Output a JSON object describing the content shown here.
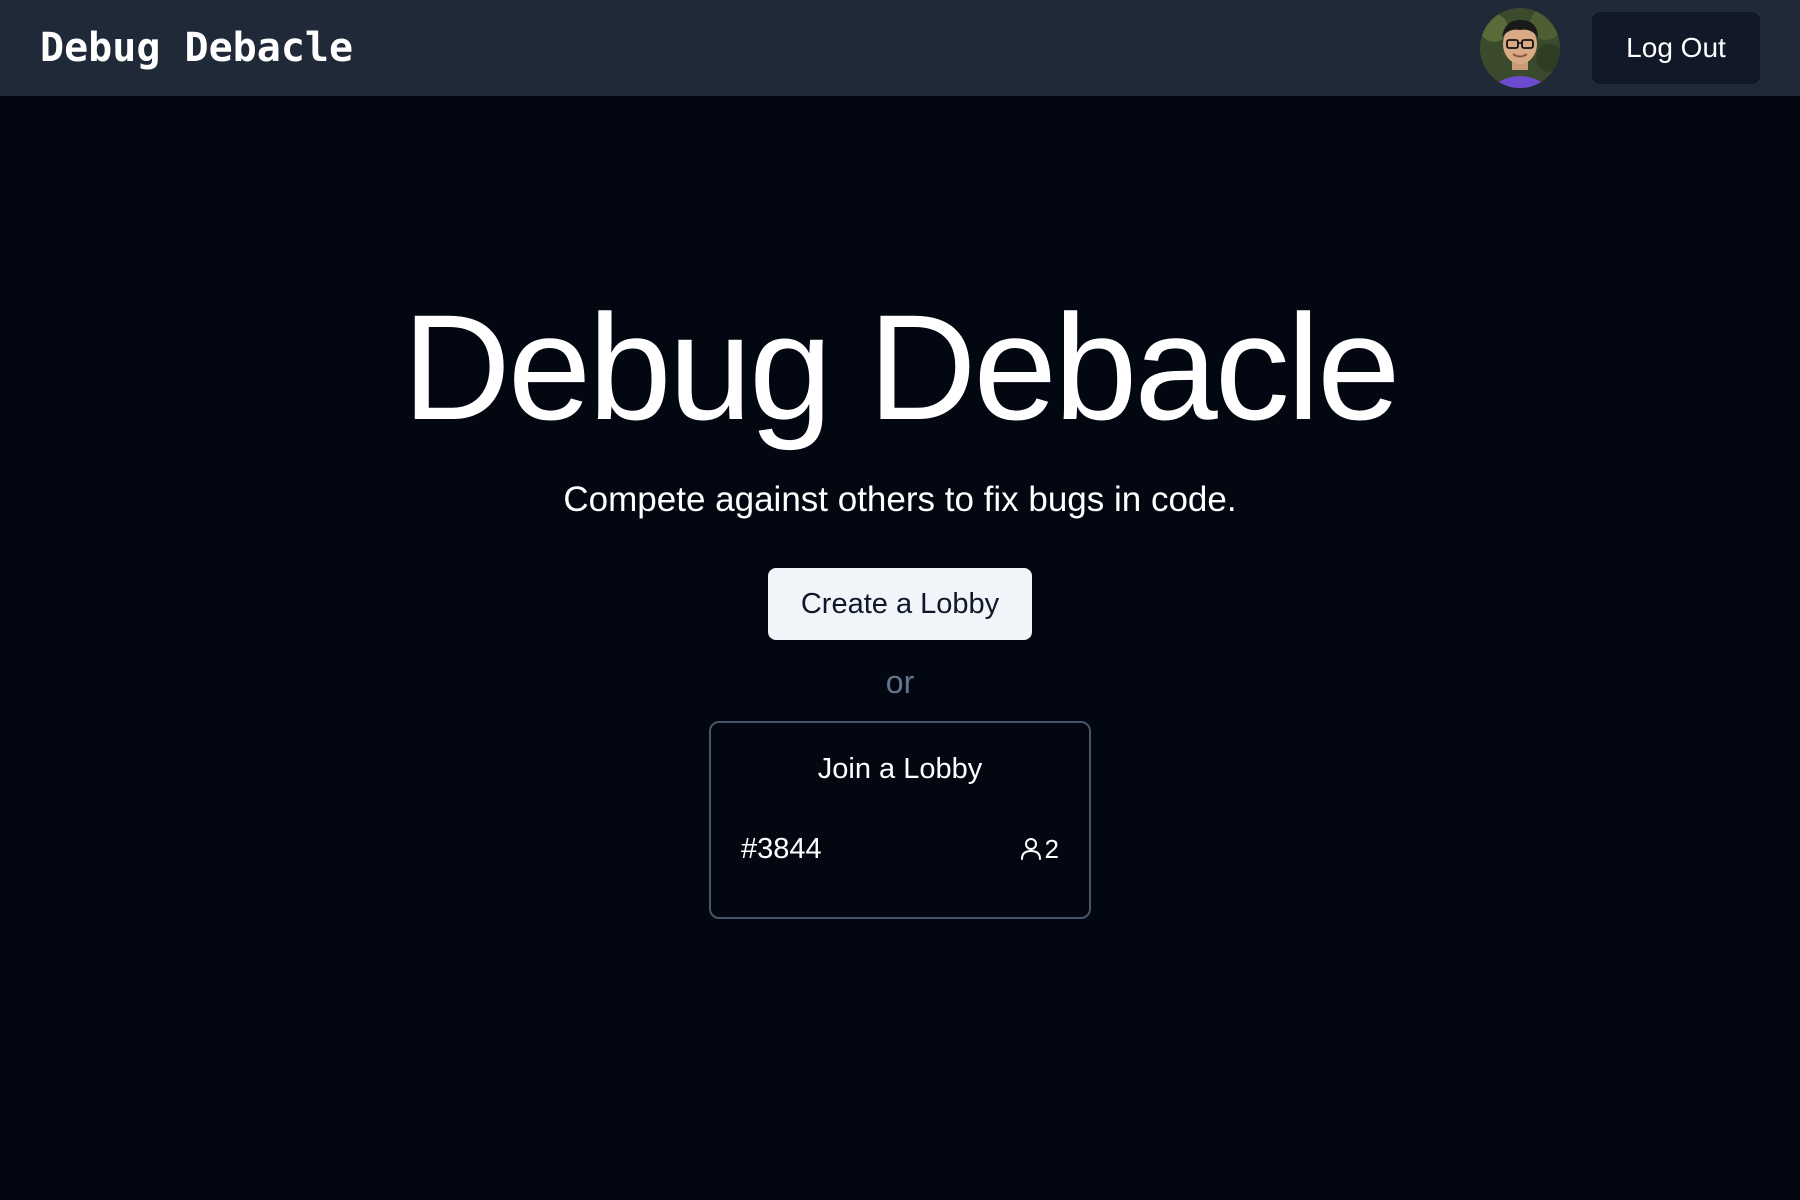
{
  "navbar": {
    "brand": "Debug Debacle",
    "logout_label": "Log Out",
    "avatar_icon": "user-avatar"
  },
  "hero": {
    "title": "Debug Debacle",
    "subtitle": "Compete against others to fix bugs in code."
  },
  "actions": {
    "create_label": "Create a Lobby",
    "or_label": "or"
  },
  "join": {
    "title": "Join a Lobby",
    "lobbies": [
      {
        "id": "#3844",
        "players": "2",
        "icon": "user-icon"
      }
    ]
  },
  "colors": {
    "background": "#030712",
    "navbar": "#1f2937",
    "button_light": "#f1f5f9",
    "muted_text": "#64748b",
    "card_border": "#475569"
  }
}
